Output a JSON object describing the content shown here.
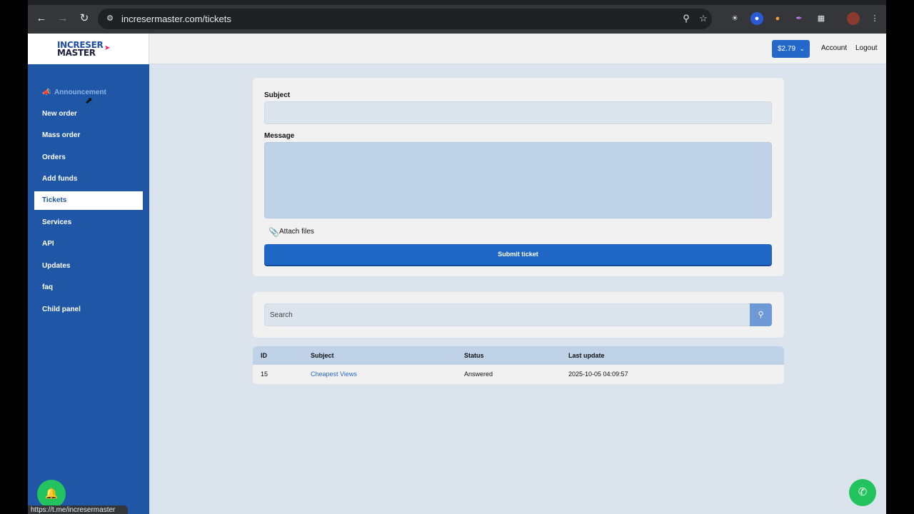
{
  "browser": {
    "url": "incresermaster.com/tickets",
    "status_url": "https://t.me/incresermaster"
  },
  "header": {
    "logo_line1": "INCRESER",
    "logo_line2": "MASTER",
    "balance": "$2.79",
    "account": "Account",
    "logout": "Logout"
  },
  "sidebar": {
    "announcement": "Announcement",
    "items": [
      {
        "label": "New order"
      },
      {
        "label": "Mass order"
      },
      {
        "label": "Orders"
      },
      {
        "label": "Add funds"
      },
      {
        "label": "Tickets",
        "active": true
      },
      {
        "label": "Services"
      },
      {
        "label": "API"
      },
      {
        "label": "Updates"
      },
      {
        "label": "faq"
      },
      {
        "label": "Child panel"
      }
    ]
  },
  "ticket_form": {
    "subject_label": "Subject",
    "subject_value": "",
    "message_label": "Message",
    "message_value": "",
    "attach_label": "Attach files",
    "submit_label": "Submit ticket"
  },
  "search": {
    "placeholder": "Search"
  },
  "tickets_table": {
    "columns": [
      "ID",
      "Subject",
      "Status",
      "Last update"
    ],
    "rows": [
      {
        "id": "15",
        "subject": "Cheapest Views",
        "status": "Answered",
        "last_update": "2025-10-05 04:09:57"
      }
    ]
  },
  "colors": {
    "sidebar": "#1f56a6",
    "accent": "#2469c9",
    "whatsapp": "#22c35e"
  }
}
